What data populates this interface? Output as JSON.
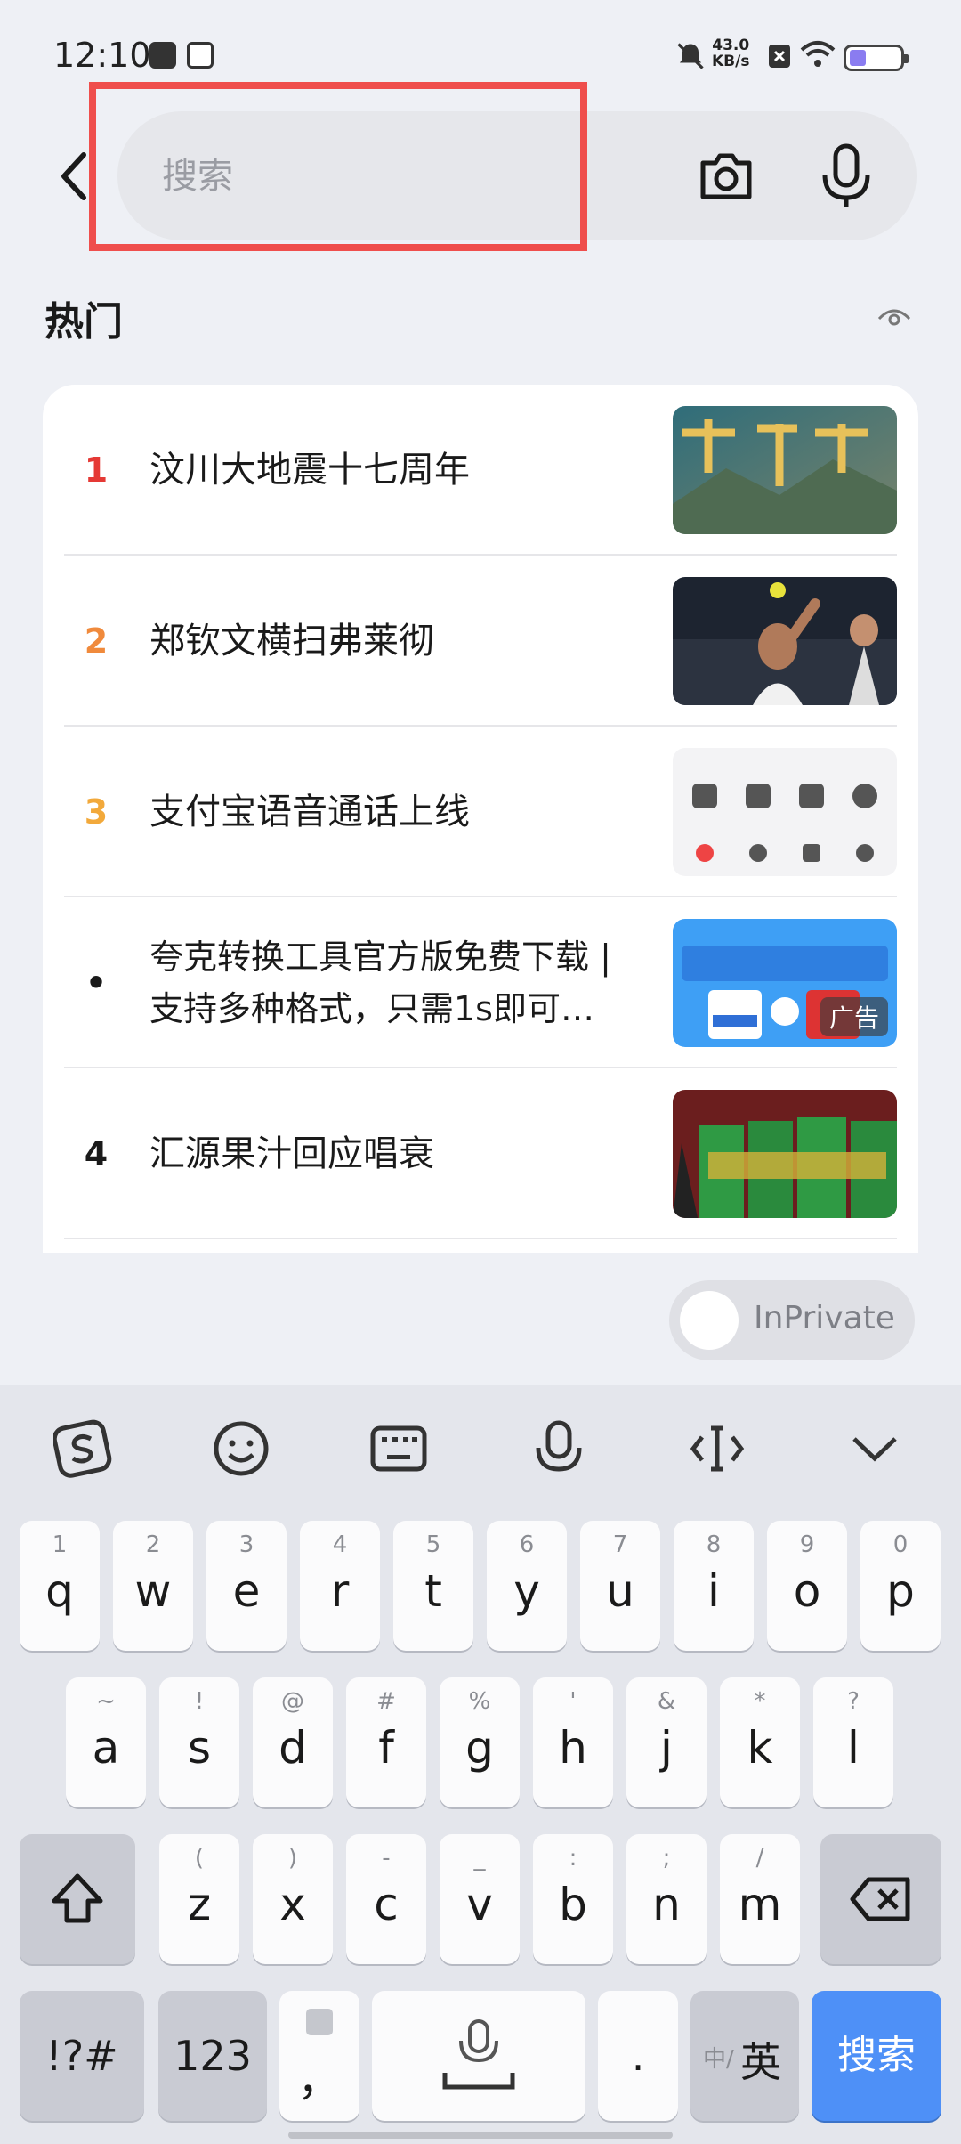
{
  "status_bar": {
    "time": "12:10",
    "net_speed": "43.0",
    "net_unit": "KB/s"
  },
  "search": {
    "placeholder": "搜索",
    "value": ""
  },
  "section": {
    "title": "热门"
  },
  "hot_list": [
    {
      "rank": "1",
      "rank_color": "#e53935",
      "title": "汶川大地震十七周年"
    },
    {
      "rank": "2",
      "rank_color": "#f08a3c",
      "title": "郑钦文横扫弗莱彻"
    },
    {
      "rank": "3",
      "rank_color": "#f2a93b",
      "title": "支付宝语音通话上线"
    },
    {
      "rank": "•",
      "rank_color": "#1a1a1a",
      "title": " 夸克转换工具官方版免费下载 | 支持多种格式，只需1s即可…",
      "tag": "广告"
    },
    {
      "rank": "4",
      "rank_color": "#1a1a1a",
      "title": "汇源果汁回应唱衰"
    }
  ],
  "inprivate": {
    "label": "InPrivate"
  },
  "keyboard": {
    "row1": [
      {
        "sub": "1",
        "main": "q"
      },
      {
        "sub": "2",
        "main": "w"
      },
      {
        "sub": "3",
        "main": "e"
      },
      {
        "sub": "4",
        "main": "r"
      },
      {
        "sub": "5",
        "main": "t"
      },
      {
        "sub": "6",
        "main": "y"
      },
      {
        "sub": "7",
        "main": "u"
      },
      {
        "sub": "8",
        "main": "i"
      },
      {
        "sub": "9",
        "main": "o"
      },
      {
        "sub": "0",
        "main": "p"
      }
    ],
    "row2": [
      {
        "sub": "~",
        "main": "a"
      },
      {
        "sub": "!",
        "main": "s"
      },
      {
        "sub": "@",
        "main": "d"
      },
      {
        "sub": "#",
        "main": "f"
      },
      {
        "sub": "%",
        "main": "g"
      },
      {
        "sub": "'",
        "main": "h"
      },
      {
        "sub": "&",
        "main": "j"
      },
      {
        "sub": "*",
        "main": "k"
      },
      {
        "sub": "?",
        "main": "l"
      }
    ],
    "row3": [
      {
        "sub": "(",
        "main": "z"
      },
      {
        "sub": ")",
        "main": "x"
      },
      {
        "sub": "-",
        "main": "c"
      },
      {
        "sub": "_",
        "main": "v"
      },
      {
        "sub": ":",
        "main": "b"
      },
      {
        "sub": ";",
        "main": "n"
      },
      {
        "sub": "/",
        "main": "m"
      }
    ],
    "symbols": "!?#",
    "numbers": "123",
    "comma": "，",
    "period": ".",
    "lang_sub": "中/",
    "lang_main": "英",
    "enter": "搜索"
  },
  "colors": {
    "highlight": "#ef4e4c",
    "enter_key": "#4e90f7"
  }
}
